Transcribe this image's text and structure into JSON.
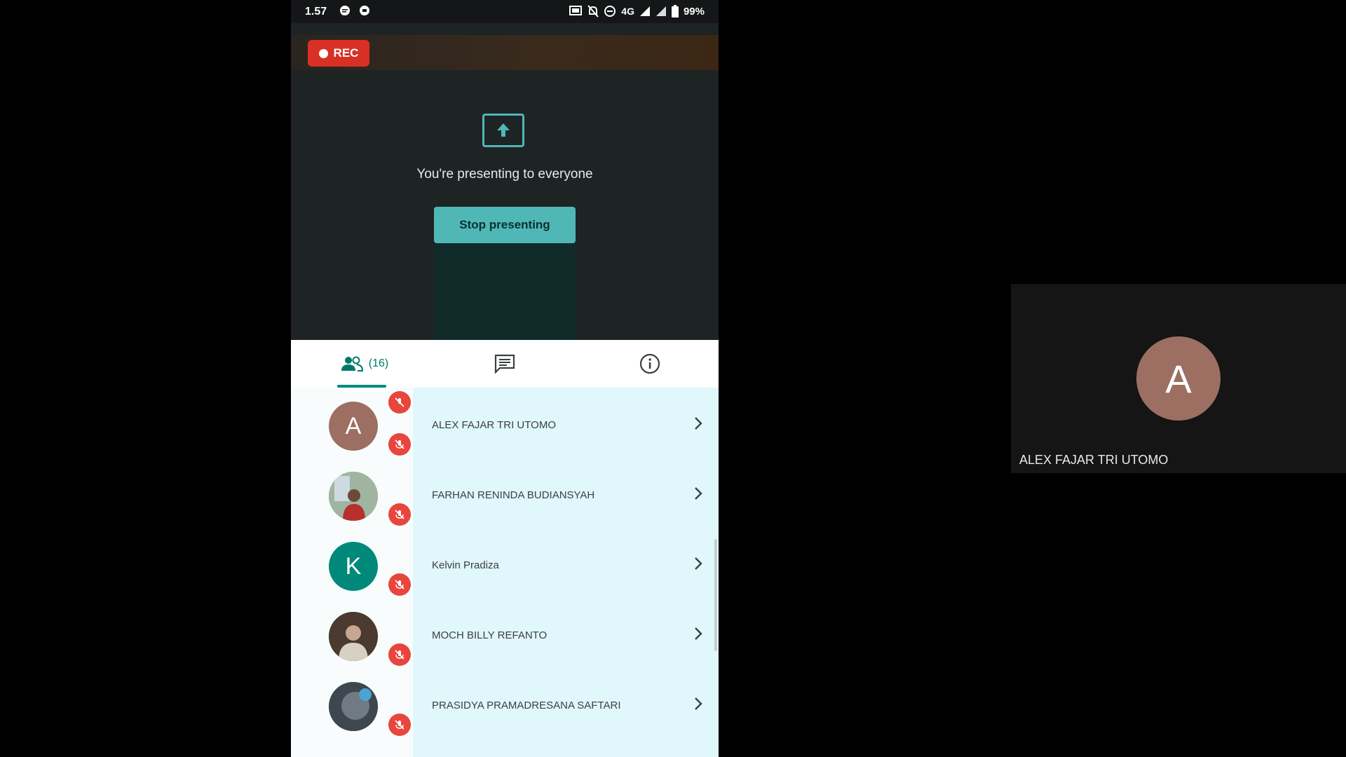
{
  "status_bar": {
    "time": "1.57",
    "network": "4G",
    "battery": "99%"
  },
  "recording": {
    "label": "REC"
  },
  "presenting": {
    "message": "You're presenting to everyone",
    "stop_button": "Stop presenting"
  },
  "tabs": {
    "people_count": "(16)"
  },
  "participants": [
    {
      "name": "ALEX FAJAR TRI UTOMO",
      "initial": "A",
      "avatar_color": "#9c6f62",
      "muted": true
    },
    {
      "name": "FARHAN RENINDA BUDIANSYAH",
      "initial": "",
      "avatar_color": "#6e8a6a",
      "muted": true
    },
    {
      "name": "Kelvin Pradiza",
      "initial": "K",
      "avatar_color": "#00897b",
      "muted": true
    },
    {
      "name": "MOCH BILLY REFANTO",
      "initial": "",
      "avatar_color": "#5a4a3e",
      "muted": true
    },
    {
      "name": "PRASIDYA PRAMADRESANA SAFTARI",
      "initial": "",
      "avatar_color": "#4f5a63",
      "muted": true
    }
  ],
  "side_tile": {
    "initial": "A",
    "name": "ALEX FAJAR TRI UTOMO"
  },
  "colors": {
    "accent": "#00897b",
    "button": "#4fb7b6",
    "rec": "#d93025",
    "mute": "#e8453c"
  }
}
